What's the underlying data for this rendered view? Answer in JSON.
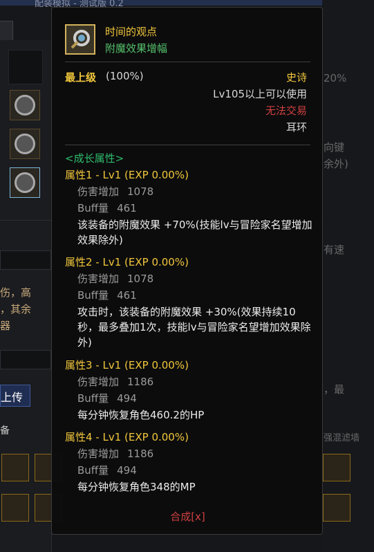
{
  "background": {
    "window_title": "配装模拟 - 测试版 0.2",
    "upload_label": "上传",
    "equip_tab_label": "备",
    "left_text_1": "伤，高",
    "left_text_2": "，其余",
    "left_text_3": "器",
    "right_pct": "20%",
    "right_text_1": "向键",
    "right_text_2": "余外)",
    "right_text_3": "有速",
    "right_text_4": "，最",
    "right_text_5": "强混滤墙"
  },
  "tooltip": {
    "item_name": "时间的观点",
    "item_subtitle": "附魔效果增幅",
    "grade_label": "最上级",
    "grade_percent": "(100%)",
    "rarity": "史诗",
    "level_requirement": "Lv105以上可以使用",
    "trade_status": "无法交易",
    "slot_type": "耳环",
    "growth_header": "<成长属性>",
    "attributes": [
      {
        "title": "属性1 - Lv1 (EXP 0.00%)",
        "damage_label": "伤害增加",
        "damage_value": "1078",
        "buff_label": "Buff量",
        "buff_value": "461",
        "description": "该装备的附魔效果 +70%(技能lv与冒险家名望增加效果除外)"
      },
      {
        "title": "属性2 - Lv1 (EXP 0.00%)",
        "damage_label": "伤害增加",
        "damage_value": "1078",
        "buff_label": "Buff量",
        "buff_value": "461",
        "description": "攻击时，该装备的附魔效果 +30%(效果持续10秒，最多叠加1次，技能lv与冒险家名望增加效果除外)"
      },
      {
        "title": "属性3 - Lv1 (EXP 0.00%)",
        "damage_label": "伤害增加",
        "damage_value": "1186",
        "buff_label": "Buff量",
        "buff_value": "494",
        "description": "每分钟恢复角色460.2的HP"
      },
      {
        "title": "属性4 - Lv1 (EXP 0.00%)",
        "damage_label": "伤害增加",
        "damage_value": "1186",
        "buff_label": "Buff量",
        "buff_value": "494",
        "description": "每分钟恢复角色348的MP"
      }
    ],
    "synthesize_button": "合成[x]"
  },
  "colors": {
    "gold": "#f2c73b",
    "green": "#55c16a",
    "growth_green": "#2ebc6b",
    "red": "#d04040",
    "stat_gray": "#9b9b9b"
  }
}
